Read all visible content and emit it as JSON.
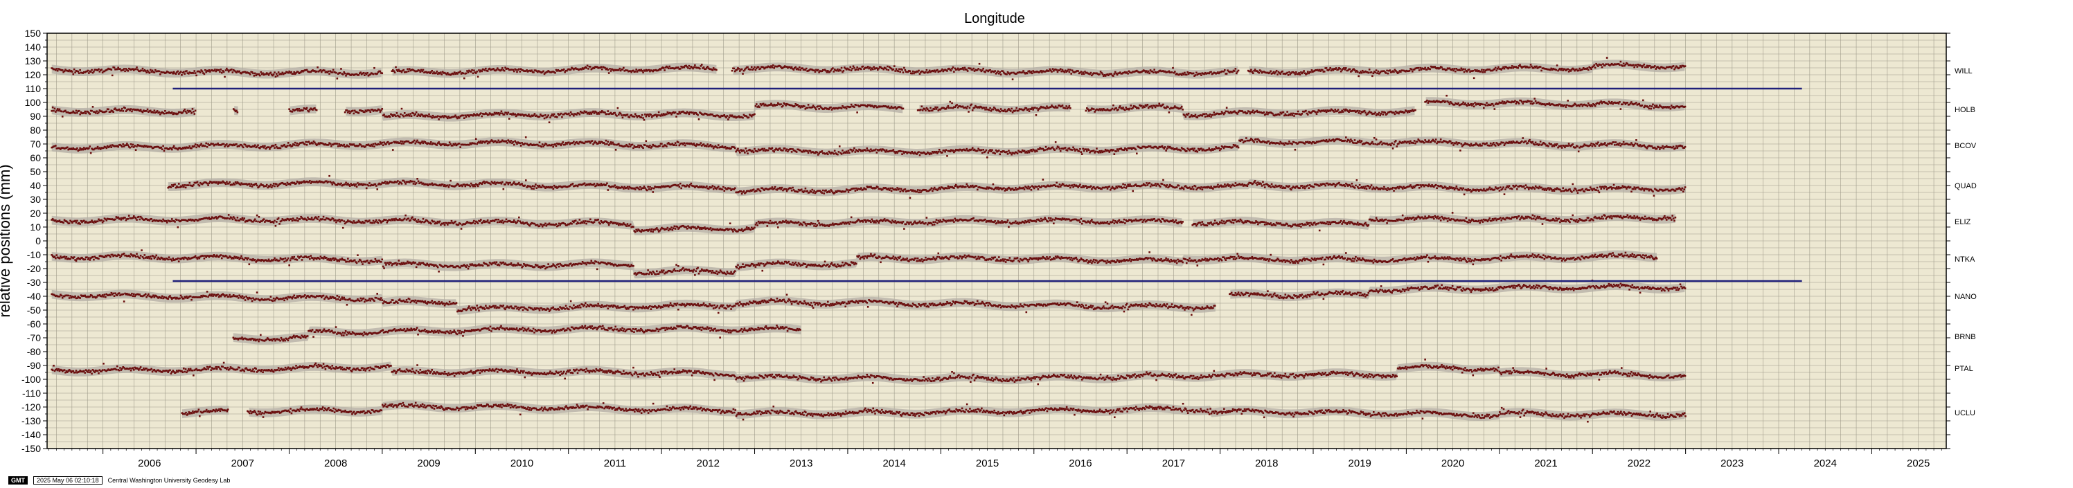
{
  "chart_data": {
    "type": "scatter",
    "title": "Longitude",
    "xlabel": "",
    "ylabel": "relative positions (mm)",
    "xlim": [
      2005.4,
      2025.8
    ],
    "ylim": [
      -150,
      150
    ],
    "x_ticks": [
      "2006",
      "2007",
      "2008",
      "2009",
      "2010",
      "2011",
      "2012",
      "2013",
      "2014",
      "2015",
      "2016",
      "2017",
      "2018",
      "2019",
      "2020",
      "2021",
      "2022",
      "2023",
      "2024",
      "2025"
    ],
    "y_ticks": [
      150,
      140,
      130,
      120,
      110,
      100,
      90,
      80,
      70,
      60,
      50,
      40,
      30,
      20,
      10,
      0,
      -10,
      -20,
      -30,
      -40,
      -50,
      -60,
      -70,
      -80,
      -90,
      -100,
      -110,
      -120,
      -130,
      -140,
      -150
    ],
    "grid": true,
    "background_color": "#ede8d2",
    "point_color": "#6b0f0f",
    "band_color": "#b3aea4",
    "separator_color": "#1f1f7a",
    "separators": [
      {
        "y": 110,
        "x_start": 2006.75,
        "x_end": 2024.25
      },
      {
        "y": -29,
        "x_start": 2006.75,
        "x_end": 2024.25
      }
    ],
    "series": [
      {
        "name": "WILL",
        "offset": 123,
        "x_start": 2005.45,
        "x_end": 2023.0,
        "gaps": [
          [
            2009.0,
            2009.1
          ],
          [
            2012.6,
            2012.75
          ],
          [
            2018.2,
            2018.3
          ]
        ],
        "steps": [
          [
            2022.0,
            2
          ]
        ]
      },
      {
        "name": "HOLB",
        "offset": 95,
        "x_start": 2005.45,
        "x_end": 2023.0,
        "gaps": [
          [
            2007.0,
            2007.4
          ],
          [
            2007.45,
            2008.0
          ],
          [
            2008.3,
            2008.6
          ],
          [
            2014.6,
            2014.75
          ],
          [
            2016.4,
            2016.55
          ],
          [
            2020.1,
            2020.2
          ]
        ],
        "steps": [
          [
            2009.0,
            -5
          ],
          [
            2013.0,
            7
          ],
          [
            2017.6,
            -5
          ],
          [
            2020.2,
            6
          ]
        ]
      },
      {
        "name": "BCOV",
        "offset": 69,
        "x_start": 2005.45,
        "x_end": 2023.0,
        "gaps": [],
        "steps": [
          [
            2012.8,
            -3
          ],
          [
            2018.2,
            4
          ]
        ]
      },
      {
        "name": "QUAD",
        "offset": 40,
        "x_start": 2006.7,
        "x_end": 2023.0,
        "gaps": [],
        "steps": [
          [
            2012.8,
            -2
          ],
          [
            2018.3,
            1
          ]
        ]
      },
      {
        "name": "ELIZ",
        "offset": 14,
        "x_start": 2005.45,
        "x_end": 2022.9,
        "gaps": [
          [
            2017.6,
            2017.7
          ]
        ],
        "steps": [
          [
            2011.7,
            -4
          ],
          [
            2013.0,
            3
          ],
          [
            2019.6,
            4
          ]
        ]
      },
      {
        "name": "NTKA",
        "offset": -13,
        "x_start": 2005.45,
        "x_end": 2022.7,
        "gaps": [],
        "steps": [
          [
            2009.0,
            -3
          ],
          [
            2011.7,
            -6
          ],
          [
            2012.8,
            4
          ],
          [
            2014.1,
            4
          ],
          [
            2017.6,
            2
          ]
        ]
      },
      {
        "name": "NANO",
        "offset": -40,
        "x_start": 2005.45,
        "x_end": 2023.0,
        "gaps": [
          [
            2017.95,
            2018.1
          ]
        ],
        "steps": [
          [
            2009.0,
            -3
          ],
          [
            2009.8,
            -5
          ],
          [
            2012.8,
            2
          ],
          [
            2018.1,
            8
          ],
          [
            2019.6,
            3
          ]
        ]
      },
      {
        "name": "BRNB",
        "offset": -69,
        "x_start": 2007.4,
        "x_end": 2013.5,
        "gaps": [],
        "steps": [
          [
            2008.2,
            4
          ]
        ]
      },
      {
        "name": "PTAL",
        "offset": -92,
        "x_start": 2005.45,
        "x_end": 2023.0,
        "gaps": [],
        "steps": [
          [
            2009.1,
            -4
          ],
          [
            2012.8,
            -2
          ],
          [
            2019.9,
            5
          ],
          [
            2021.0,
            -3
          ]
        ]
      },
      {
        "name": "UCLU",
        "offset": -124,
        "x_start": 2006.85,
        "x_end": 2023.0,
        "gaps": [
          [
            2007.35,
            2007.55
          ]
        ],
        "steps": [
          [
            2009.0,
            3
          ],
          [
            2012.8,
            -2
          ],
          [
            2017.9,
            -2
          ],
          [
            2021.0,
            1
          ]
        ]
      }
    ]
  },
  "footer": {
    "logo": "GMT",
    "timestamp": "2025 May 06 02:10:18",
    "credit": "Central Washington University Geodesy Lab"
  }
}
